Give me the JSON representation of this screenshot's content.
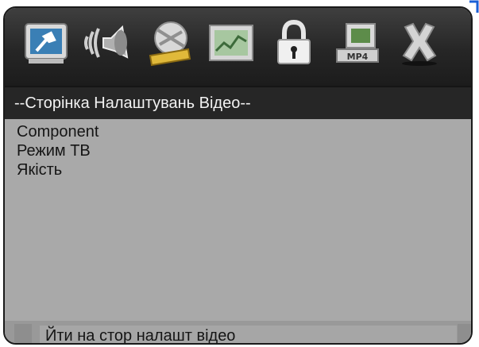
{
  "toolbar": {
    "icons": [
      {
        "name": "general-setup-icon"
      },
      {
        "name": "audio-setup-icon"
      },
      {
        "name": "video-setup-icon"
      },
      {
        "name": "preference-setup-icon"
      },
      {
        "name": "password-lock-icon"
      },
      {
        "name": "mp4-setup-icon"
      },
      {
        "name": "exit-icon"
      }
    ]
  },
  "page": {
    "title": "--Сторінка Налаштувань Відео--"
  },
  "menu": {
    "items": [
      "Component",
      "Режим ТВ",
      "Якість"
    ]
  },
  "status": {
    "text": "Йти на стор налашт відео"
  },
  "colors": {
    "toolbar_bg": "#262626",
    "panel_bg": "#a9a9a9",
    "title_bg": "#262626",
    "accent_blue": "#1a5fd6"
  }
}
